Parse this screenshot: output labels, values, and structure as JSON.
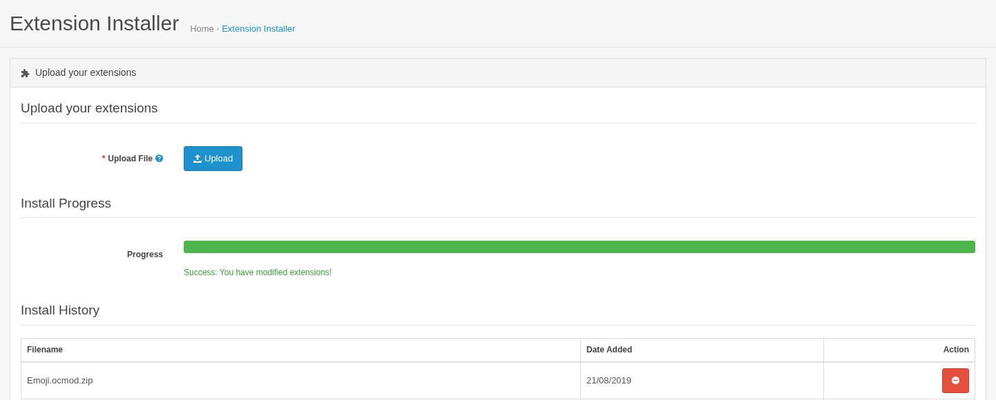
{
  "page": {
    "title": "Extension Installer"
  },
  "breadcrumb": [
    {
      "label": "Home",
      "current": false
    },
    {
      "label": "Extension Installer",
      "current": true
    }
  ],
  "breadcrumb_separator": "›",
  "panel": {
    "title": "Upload your extensions"
  },
  "upload_section": {
    "heading": "Upload your extensions",
    "field_label": "Upload File",
    "required": "*",
    "button": "Upload"
  },
  "progress_section": {
    "heading": "Install Progress",
    "label": "Progress",
    "level": 1,
    "message": "Success: You have modified extensions!"
  },
  "history": {
    "heading": "Install History",
    "columns": [
      "Filename",
      "Date Added",
      "Action"
    ],
    "rows": [
      {
        "filename": "Emoji.ocmod.zip",
        "date": "21/08/2019"
      }
    ]
  }
}
